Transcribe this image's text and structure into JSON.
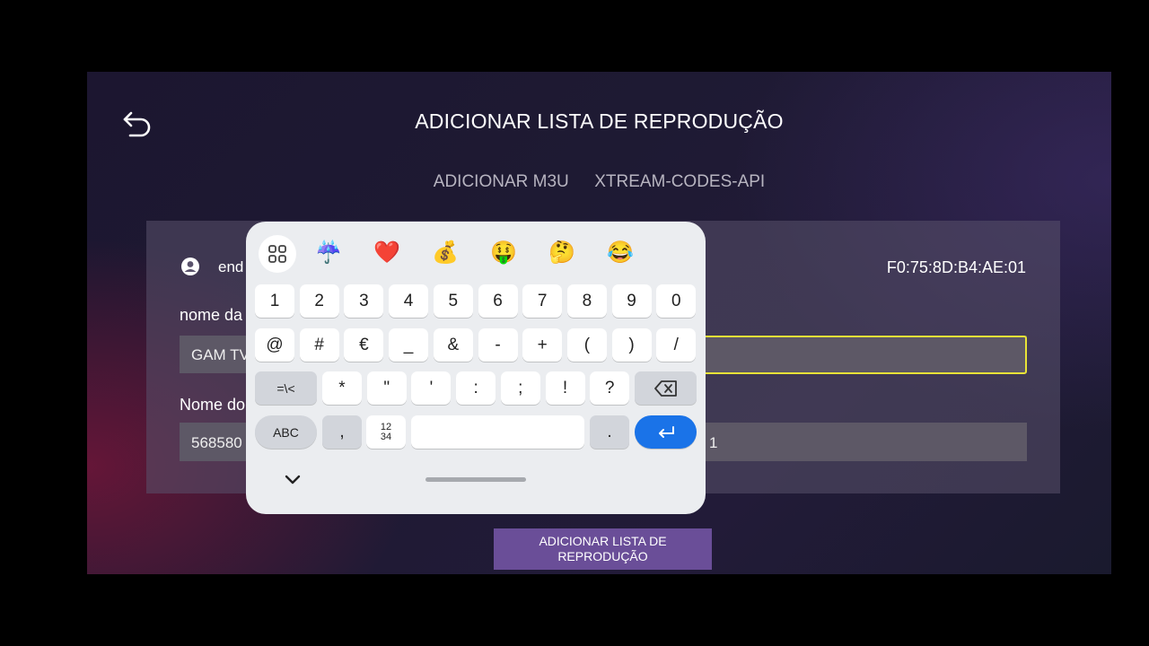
{
  "header": {
    "title": "ADICIONAR LISTA DE REPRODUÇÃO",
    "back_icon": "undo-arrow-icon"
  },
  "tabs": [
    {
      "label": "ADICIONAR M3U"
    },
    {
      "label": "XTREAM-CODES-API"
    }
  ],
  "form": {
    "address_label_partial": "end",
    "mac": "F0:75:8D:B4:AE:01",
    "name_label_partial": "nome da",
    "name_value_partial": "GAM TV",
    "user_label_partial": "Nome do",
    "user_value_partial": "568580",
    "user_value_tail": "1"
  },
  "submit": {
    "label": "ADICIONAR LISTA DE REPRODUÇÃO"
  },
  "keyboard": {
    "emojis": [
      "☔",
      "❤️",
      "💰",
      "🤑",
      "🤔",
      "😂"
    ],
    "row1": [
      "1",
      "2",
      "3",
      "4",
      "5",
      "6",
      "7",
      "8",
      "9",
      "0"
    ],
    "row2": [
      "@",
      "#",
      "€",
      "_",
      "&",
      "-",
      "+",
      "(",
      ")",
      "/"
    ],
    "row3": [
      "*",
      "\"",
      "'",
      ":",
      ";",
      "!",
      "?"
    ],
    "more_symbols": "=\\<",
    "abc": "ABC",
    "comma": ",",
    "numpad": "12\n34",
    "period": "."
  },
  "colors": {
    "accent_button": "#6a4e98",
    "focus_border": "#e8e337",
    "enter_key": "#1a73e8"
  }
}
